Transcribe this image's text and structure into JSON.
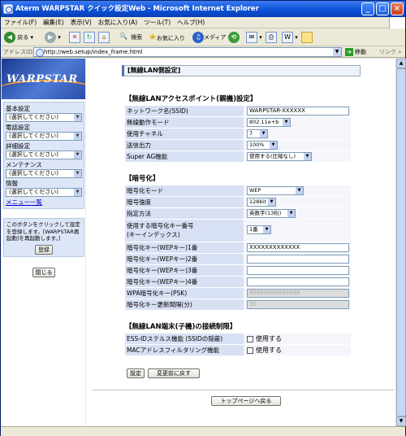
{
  "window": {
    "title": "Aterm WARPSTAR クイック設定Web - Microsoft Internet Explorer",
    "min": "_",
    "max": "□",
    "close": "×"
  },
  "menu": [
    "ファイル(F)",
    "編集(E)",
    "表示(V)",
    "お気に入り(A)",
    "ツール(T)",
    "ヘルプ(H)"
  ],
  "toolbar": {
    "back": "戻る",
    "search": "検索",
    "favorites": "お気に入り",
    "media": "メディア"
  },
  "address": {
    "label": "アドレス(D)",
    "url": "http://web.setup/index_frame.html",
    "go": "移動",
    "links": "リンク"
  },
  "logo": "WARPSTAR",
  "nav": [
    {
      "heading": "基本設定",
      "select": "(選択してください)"
    },
    {
      "heading": "電話設定",
      "select": "(選択してください)"
    },
    {
      "heading": "詳細設定",
      "select": "(選択してください)"
    },
    {
      "heading": "メンテナンス",
      "select": "(選択してください)"
    },
    {
      "heading": "情報",
      "select": "(選択してください)"
    }
  ],
  "menu_list": "メニュー一覧",
  "note": {
    "text": "このボタンをクリックして設定を登録します。[WARPSTAR再起動]を再起動します。]",
    "register": "登録"
  },
  "close_button": "閉じる",
  "page_title": "[無線LAN側設定]",
  "ap_section": {
    "heading": "【無線LANアクセスポイント(親機)設定】",
    "rows": [
      {
        "label": "ネットワーク名(SSID)",
        "value": "WARPSTAR-XXXXXX"
      },
      {
        "label": "無線動作モード",
        "value": "802.11e+b"
      },
      {
        "label": "使用チャネル",
        "value": "7"
      },
      {
        "label": "送信出力",
        "value": "100%"
      },
      {
        "label": "Super AG機能",
        "value": "使用する(圧縮なし)"
      }
    ]
  },
  "enc_section": {
    "heading": "【暗号化】",
    "mode": {
      "label": "暗号化モード",
      "value": "WEP"
    },
    "strength": {
      "label": "暗号強度",
      "value": "128bit"
    },
    "method": {
      "label": "指定方法",
      "value": "英数字(13桁)"
    },
    "key_index": {
      "label": "使用する暗号化キー番号\n(キーインデックス)",
      "value": "1番"
    },
    "key1": {
      "label": "暗号化キー(WEPキー)1番",
      "value": "XXXXXXXXXXXXX"
    },
    "key2": {
      "label": "暗号化キー(WEPキー)2番",
      "value": ""
    },
    "key3": {
      "label": "暗号化キー(WEPキー)3番",
      "value": ""
    },
    "key4": {
      "label": "暗号化キー(WEPキー)4番",
      "value": ""
    },
    "psk": {
      "label": "WPA暗号化キー(PSK)",
      "value": "88888888888888"
    },
    "interval": {
      "label": "暗号化キー更新間隔(分)",
      "value": "30"
    }
  },
  "sta_section": {
    "heading": "【無線LAN端末(子機)の接続制限】",
    "ess": {
      "label": "ESS-IDステルス機能 (SSIDの隠蔽)",
      "check": "使用する"
    },
    "mac": {
      "label": "MACアドレスフィルタリング機能",
      "check": "使用する"
    }
  },
  "buttons": {
    "set": "設定",
    "revert": "変更前に戻す",
    "top": "トップページへ戻る"
  }
}
